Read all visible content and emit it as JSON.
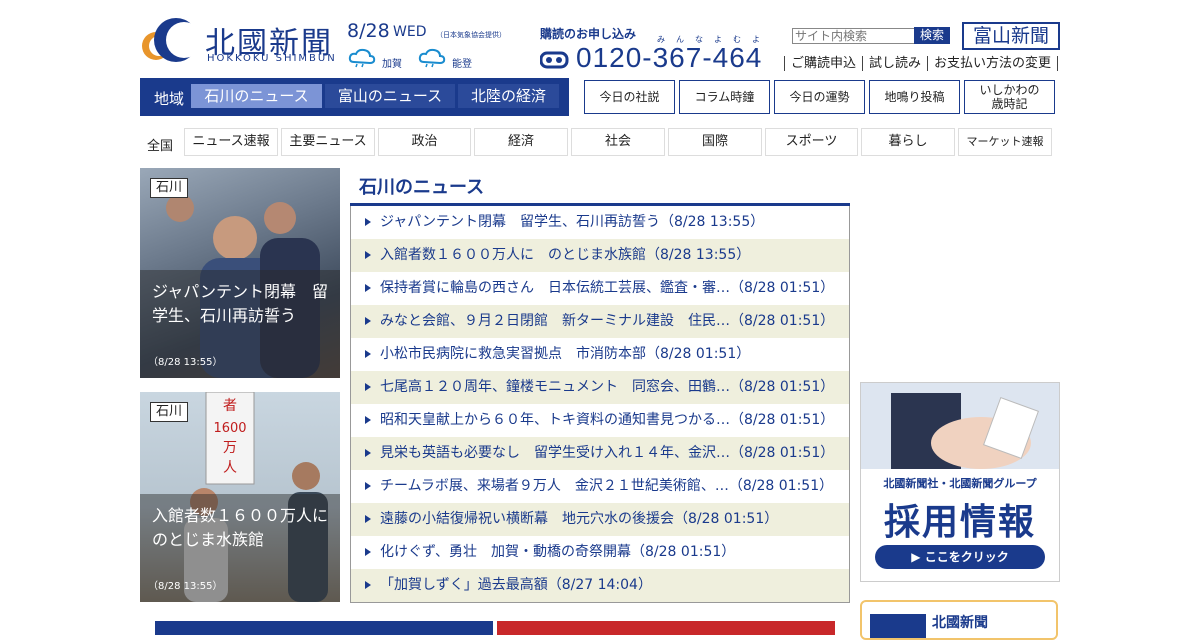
{
  "header": {
    "brand": "北國新聞",
    "brand_sub": "HOKKOKU SHIMBUN",
    "date": "8/28",
    "dow": "WED",
    "weather_note": "（日本気象協会提供）",
    "weather": [
      {
        "area": "加賀",
        "icon": "cloud-rain-icon"
      },
      {
        "area": "能登",
        "icon": "cloud-rain-icon"
      }
    ],
    "subscribe_title": "購読のお申し込み",
    "phone_ruby": "みんなよむよ",
    "phone": "0120-367-464",
    "search_placeholder": "サイト内検索",
    "search_button": "検索",
    "toyama_brand": "富山新聞",
    "links": [
      "ご購読申込",
      "試し読み",
      "お支払い方法の変更"
    ]
  },
  "region_nav": {
    "label": "地域",
    "tabs": [
      {
        "label": "石川のニュース",
        "active": true
      },
      {
        "label": "富山のニュース",
        "active": false
      },
      {
        "label": "北陸の経済",
        "active": false
      }
    ]
  },
  "side_nav": [
    "今日の社説",
    "コラム時鐘",
    "今日の運勢",
    "地鳴り投稿",
    "いしかわの\n歳時記"
  ],
  "categories": {
    "label": "全国",
    "items": [
      "ニュース速報",
      "主要ニュース",
      "政治",
      "経済",
      "社会",
      "国際",
      "スポーツ",
      "暮らし",
      "マーケット速報"
    ]
  },
  "feature_cards": [
    {
      "tag": "石川",
      "title": "ジャパンテント閉幕　留学生、石川再訪誓う",
      "time": "（8/28 13:55）"
    },
    {
      "tag": "石川",
      "title": "入館者数１６００万人に　のとじま水族館",
      "time": "（8/28 13:55）",
      "sign_text": "者1600万人"
    }
  ],
  "ishikawa_news": {
    "heading": "石川のニュース",
    "items": [
      "ジャパンテント閉幕　留学生、石川再訪誓う（8/28 13:55）",
      "入館者数１６００万人に　のとじま水族館（8/28 13:55）",
      "保持者賞に輪島の西さん　日本伝統工芸展、鑑査・審…（8/28 01:51）",
      "みなと会館、９月２日閉館　新ターミナル建設　住民…（8/28 01:51）",
      "小松市民病院に救急実習拠点　市消防本部（8/28 01:51）",
      "七尾高１２０周年、鐘楼モニュメント　同窓会、田鶴…（8/28 01:51）",
      "昭和天皇献上から６０年、トキ資料の通知書見つかる…（8/28 01:51）",
      "見栄も英語も必要なし　留学生受け入れ１４年、金沢…（8/28 01:51）",
      "チームラボ展、来場者９万人　金沢２１世紀美術館、…（8/28 01:51）",
      "遠藤の小結復帰祝い横断幕　地元穴水の後援会（8/28 01:51）",
      "化けぐず、勇壮　加賀・動橋の奇祭開幕（8/28 01:51）",
      "「加賀しずく」過去最高額（8/27 14:04）"
    ]
  },
  "recruit_ad": {
    "subtitle": "北國新聞社・北國新聞グループ",
    "title": "採用情報",
    "button": "▶ ここをクリック"
  },
  "promo": {
    "title": "北國新聞"
  },
  "colors": {
    "brand": "#1a3a8c",
    "active_tab": "#7c94d6",
    "stripe": "#efefdd"
  }
}
